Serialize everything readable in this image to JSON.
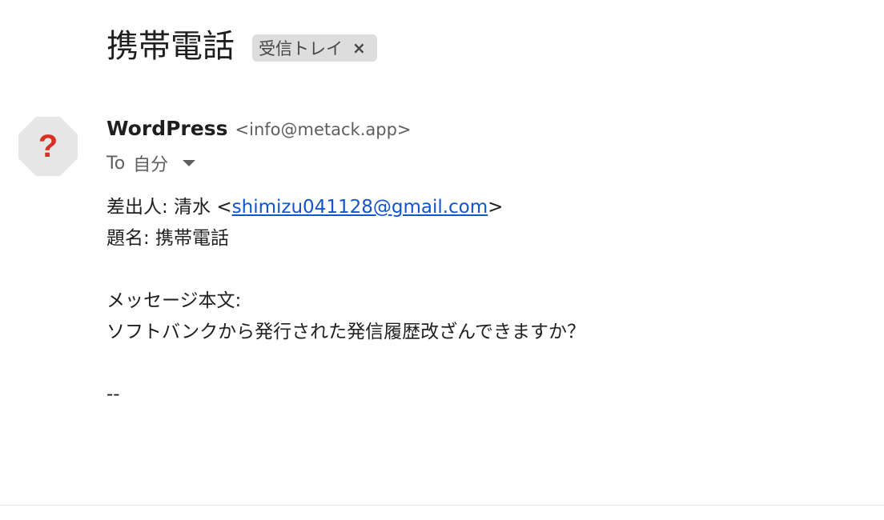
{
  "subject": "携帯電話",
  "label": {
    "text": "受信トレイ",
    "close": "×"
  },
  "avatar": {
    "glyph": "?",
    "color": "#d93025",
    "background": "#e6e6e6"
  },
  "sender": {
    "name": "WordPress",
    "email": "<info@metack.app>"
  },
  "recipient": {
    "to_label": "To",
    "name": "自分"
  },
  "body": {
    "from_prefix": "差出人: 清水 <",
    "from_email": "shimizu041128@gmail.com",
    "from_suffix": ">",
    "subject_line": "題名: 携帯電話",
    "message_label": "メッセージ本文:",
    "message_text": "ソフトバンクから発行された発信履歴改ざんできますか？",
    "signature": "--"
  }
}
